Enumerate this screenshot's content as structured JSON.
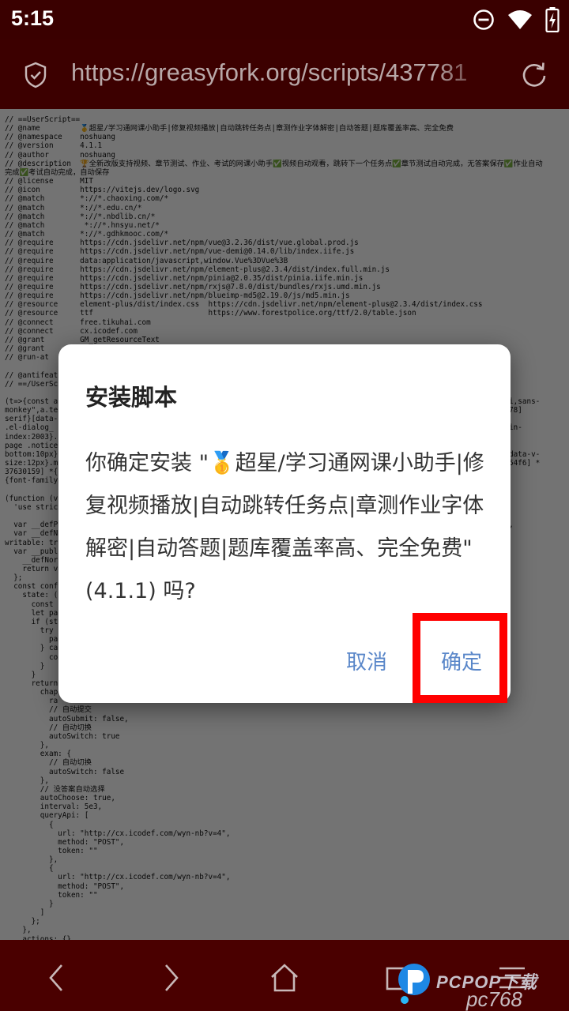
{
  "status_bar": {
    "time": "5:15"
  },
  "url_bar": {
    "url": "https://greasyfork.org/scripts/437781"
  },
  "page": {
    "code_lines": [
      "// ==UserScript==",
      "// @name         🥇超星/学习通网课小助手|修复视频播放|自动跳转任务点|章测作业字体解密|自动答题|题库覆盖率高、完全免费",
      "// @namespace    noshuang",
      "// @version      4.1.1",
      "// @author       noshuang",
      "// @description  🏆全新改版支持视频、章节测试、作业、考试的网课小助手✅视频自动观看，跳转下一个任务点✅章节测试自动完成，无答案保存✅作业自动",
      "完成✅考试自动完成，自动保存",
      "// @license      MIT",
      "// @icon         https://vitejs.dev/logo.svg",
      "// @match        *://*.chaoxing.com/*",
      "// @match        *://*.edu.cn/*",
      "// @match        *://*.nbdlib.cn/*",
      "// @match         *://*.hnsyu.net/*",
      "// @match        *://*.gdhkmooc.com/*",
      "// @require      https://cdn.jsdelivr.net/npm/vue@3.2.36/dist/vue.global.prod.js",
      "// @require      https://cdn.jsdelivr.net/npm/vue-demi@0.14.0/lib/index.iife.js",
      "// @require      data:application/javascript,window.Vue%3DVue%3B",
      "// @require      https://cdn.jsdelivr.net/npm/element-plus@2.3.4/dist/index.full.min.js",
      "// @require      https://cdn.jsdelivr.net/npm/pinia@2.0.35/dist/pinia.iife.min.js",
      "// @require      https://cdn.jsdelivr.net/npm/rxjs@7.8.0/dist/bundles/rxjs.umd.min.js",
      "// @require      https://cdn.jsdelivr.net/npm/blueimp-md5@2.19.0/js/md5.min.js",
      "// @resource     element-plus/dist/index.css  https://cdn.jsdelivr.net/npm/element-plus@2.3.4/dist/index.css",
      "// @resource     ttf                          https://www.forestpolice.org/ttf/2.0/table.json",
      "// @connect      free.tikuhai.com",
      "// @connect      cx.icodef.com",
      "// @grant        GM_getResourceText",
      "// @grant",
      "// @run-at",
      "",
      "// @antifeat",
      "// ==/UserSc",
      "",
      "(t=>{const a                                                                                                  YaHei,sans-",
      "monkey\",a.te                                                                                                  f09478]",
      "serif}[data-",
      ".el-dialog_                                                                                                  r}.main-",
      "index:2003}.",
      "page .notice                                                                                                  t-",
      "bottom:10px}                                                                                                  px}[data-v-",
      "size:12px}.m                                                                                                  68e354f6] *",
      "37630159] *{",
      "{font-family",
      "",
      "(function (v",
      "  'use stric",
      "",
      "  var __defP                                                                                                  true,",
      "  var __defN",
      "writable: tr",
      "  var __publ",
      "    __defNor",
      "    return v",
      "  };",
      "  const conf",
      "    state: (",
      "      const",
      "      let pa",
      "      if (st",
      "        try",
      "          pa",
      "        } ca",
      "          co",
      "        }",
      "      }",
      "      return",
      "        chap",
      "          ra",
      "          // 自动提交",
      "          autoSubmit: false,",
      "          // 自动切换",
      "          autoSwitch: true",
      "        },",
      "        exam: {",
      "          // 自动切换",
      "          autoSwitch: false",
      "        },",
      "        // 没答案自动选择",
      "        autoChoose: true,",
      "        interval: 5e3,",
      "        queryApi: [",
      "          {",
      "            url: \"http://cx.icodef.com/wyn-nb?v=4\",",
      "            method: \"POST\",",
      "            token: \"\"",
      "          },",
      "          {",
      "            url: \"http://cx.icodef.com/wyn-nb?v=4\",",
      "            method: \"POST\",",
      "            token: \"\"",
      "          }",
      "        ]",
      "      };",
      "    },",
      "    actions: {}"
    ]
  },
  "dialog": {
    "title": "安装脚本",
    "message": "你确定安装 \"🥇超星/学习通网课小助手|修复视频播放|自动跳转任务点|章测作业字体解密|自动答题|题库覆盖率高、完全免费\"(4.1.1) 吗?",
    "cancel_label": "取消",
    "confirm_label": "确定"
  },
  "watermark": {
    "brand": "PCPOP下载",
    "domain": "pc768"
  },
  "colors": {
    "status_bar_bg": "#3a0000",
    "url_bar_bg": "#3c0000",
    "nav_bar_bg": "#4a0000",
    "dialog_button": "#5a87c9",
    "highlight_border": "#ff0000"
  },
  "icons": {
    "status": [
      "dnd-icon",
      "wifi-icon",
      "battery-charging-icon"
    ],
    "url_bar": [
      "shield-icon",
      "reload-icon"
    ],
    "nav": [
      "back-icon",
      "forward-icon",
      "home-icon",
      "tabs-icon",
      "menu-icon"
    ]
  }
}
